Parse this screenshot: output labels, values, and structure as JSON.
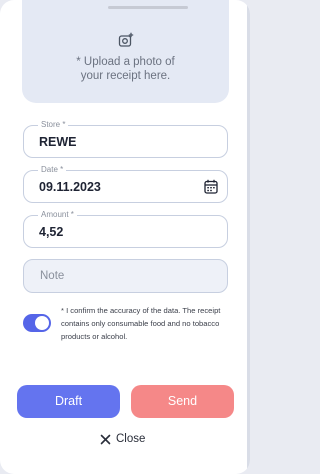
{
  "upload": {
    "line1": "* Upload a photo of",
    "line2": "your receipt here.",
    "icon": "add-photo-icon"
  },
  "fields": {
    "store": {
      "label": "Store *",
      "value": "REWE"
    },
    "date": {
      "label": "Date *",
      "value": "09.11.2023",
      "icon": "calendar-icon"
    },
    "amount": {
      "label": "Amount *",
      "value": "4,52"
    },
    "note": {
      "placeholder": "Note"
    }
  },
  "consent": {
    "checked": true,
    "text": "* I confirm the accuracy of the data. The receipt contains only consumable food and no tobacco products or alcohol."
  },
  "actions": {
    "draft_label": "Draft",
    "send_label": "Send",
    "close_label": "Close"
  },
  "colors": {
    "primary": "#6474ef",
    "danger": "#f58888",
    "toggle_on": "#5565e8",
    "upload_bg": "#e4e9f4"
  }
}
